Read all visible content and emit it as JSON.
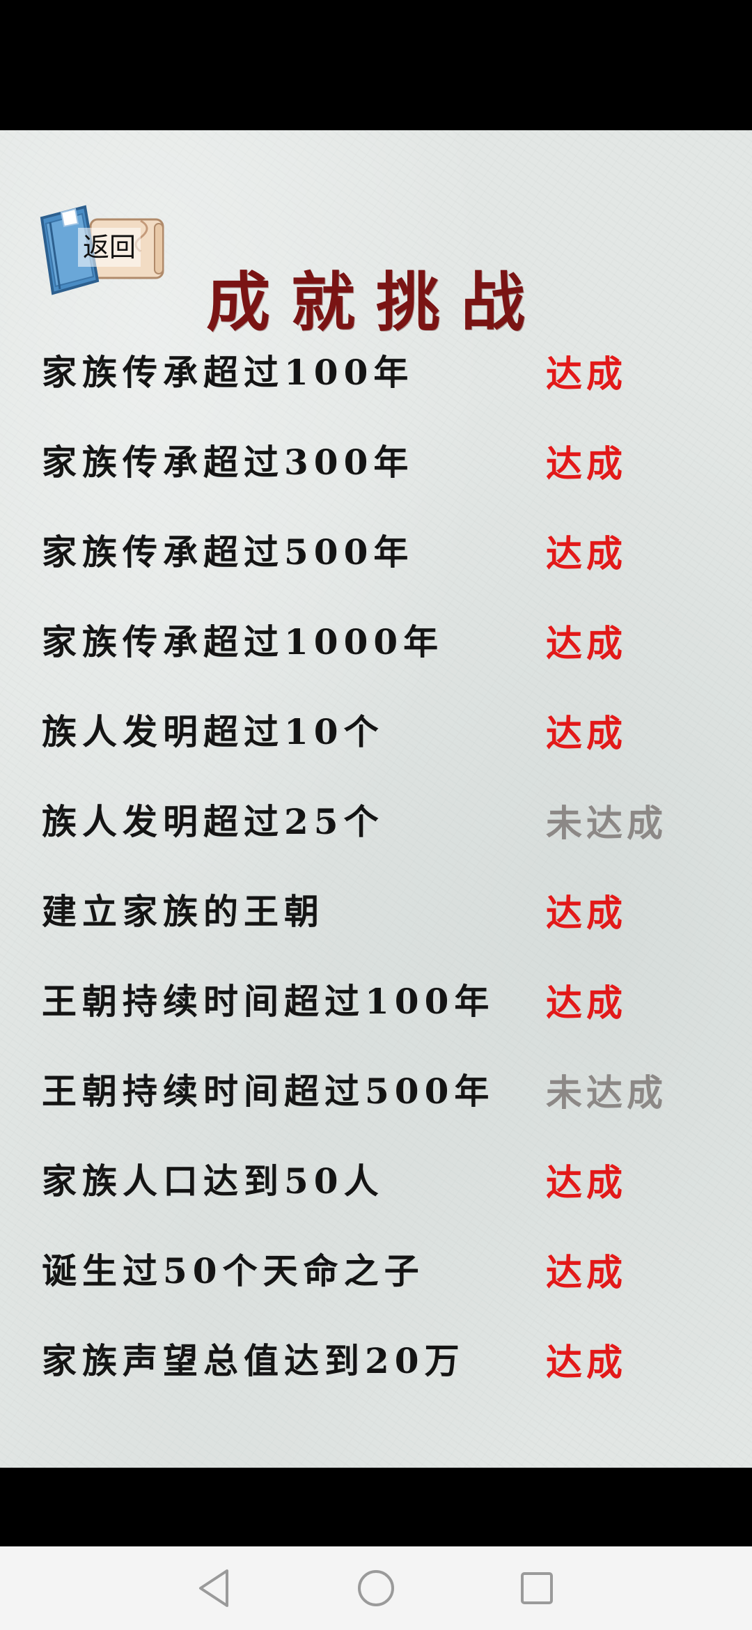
{
  "back_button": {
    "label": "返回"
  },
  "page": {
    "title": "成就挑战"
  },
  "achievements": [
    {
      "name": "家族传承超过100年",
      "status": "达成",
      "achieved": true
    },
    {
      "name": "家族传承超过300年",
      "status": "达成",
      "achieved": true
    },
    {
      "name": "家族传承超过500年",
      "status": "达成",
      "achieved": true
    },
    {
      "name": "家族传承超过1000年",
      "status": "达成",
      "achieved": true
    },
    {
      "name": "族人发明超过10个",
      "status": "达成",
      "achieved": true
    },
    {
      "name": "族人发明超过25个",
      "status": "未达成",
      "achieved": false
    },
    {
      "name": "建立家族的王朝",
      "status": "达成",
      "achieved": true
    },
    {
      "name": "王朝持续时间超过100年",
      "status": "达成",
      "achieved": true
    },
    {
      "name": "王朝持续时间超过500年",
      "status": "未达成",
      "achieved": false
    },
    {
      "name": "家族人口达到50人",
      "status": "达成",
      "achieved": true
    },
    {
      "name": "诞生过50个天命之子",
      "status": "达成",
      "achieved": true
    },
    {
      "name": "家族声望总值达到20万",
      "status": "达成",
      "achieved": true
    }
  ],
  "colors": {
    "title": "#7a1414",
    "achieved": "#e31919",
    "not_achieved": "#8c8886",
    "paper": "#e3e7e5"
  },
  "navigation": {
    "back_icon": "triangle-back-icon",
    "home_icon": "circle-home-icon",
    "recents_icon": "square-recents-icon"
  }
}
